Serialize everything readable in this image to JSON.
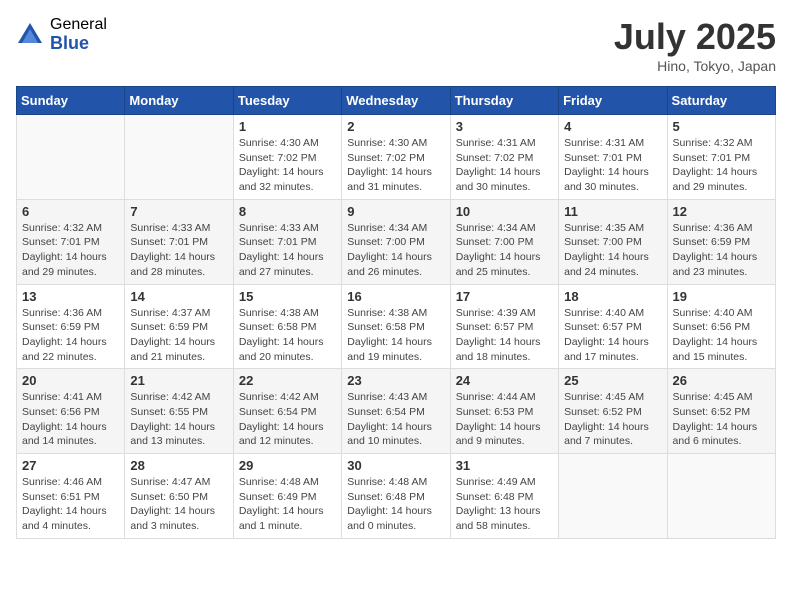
{
  "header": {
    "logo_general": "General",
    "logo_blue": "Blue",
    "month_year": "July 2025",
    "location": "Hino, Tokyo, Japan"
  },
  "weekdays": [
    "Sunday",
    "Monday",
    "Tuesday",
    "Wednesday",
    "Thursday",
    "Friday",
    "Saturday"
  ],
  "weeks": [
    [
      {
        "day": "",
        "sunrise": "",
        "sunset": "",
        "daylight": ""
      },
      {
        "day": "",
        "sunrise": "",
        "sunset": "",
        "daylight": ""
      },
      {
        "day": "1",
        "sunrise": "Sunrise: 4:30 AM",
        "sunset": "Sunset: 7:02 PM",
        "daylight": "Daylight: 14 hours and 32 minutes."
      },
      {
        "day": "2",
        "sunrise": "Sunrise: 4:30 AM",
        "sunset": "Sunset: 7:02 PM",
        "daylight": "Daylight: 14 hours and 31 minutes."
      },
      {
        "day": "3",
        "sunrise": "Sunrise: 4:31 AM",
        "sunset": "Sunset: 7:02 PM",
        "daylight": "Daylight: 14 hours and 30 minutes."
      },
      {
        "day": "4",
        "sunrise": "Sunrise: 4:31 AM",
        "sunset": "Sunset: 7:01 PM",
        "daylight": "Daylight: 14 hours and 30 minutes."
      },
      {
        "day": "5",
        "sunrise": "Sunrise: 4:32 AM",
        "sunset": "Sunset: 7:01 PM",
        "daylight": "Daylight: 14 hours and 29 minutes."
      }
    ],
    [
      {
        "day": "6",
        "sunrise": "Sunrise: 4:32 AM",
        "sunset": "Sunset: 7:01 PM",
        "daylight": "Daylight: 14 hours and 29 minutes."
      },
      {
        "day": "7",
        "sunrise": "Sunrise: 4:33 AM",
        "sunset": "Sunset: 7:01 PM",
        "daylight": "Daylight: 14 hours and 28 minutes."
      },
      {
        "day": "8",
        "sunrise": "Sunrise: 4:33 AM",
        "sunset": "Sunset: 7:01 PM",
        "daylight": "Daylight: 14 hours and 27 minutes."
      },
      {
        "day": "9",
        "sunrise": "Sunrise: 4:34 AM",
        "sunset": "Sunset: 7:00 PM",
        "daylight": "Daylight: 14 hours and 26 minutes."
      },
      {
        "day": "10",
        "sunrise": "Sunrise: 4:34 AM",
        "sunset": "Sunset: 7:00 PM",
        "daylight": "Daylight: 14 hours and 25 minutes."
      },
      {
        "day": "11",
        "sunrise": "Sunrise: 4:35 AM",
        "sunset": "Sunset: 7:00 PM",
        "daylight": "Daylight: 14 hours and 24 minutes."
      },
      {
        "day": "12",
        "sunrise": "Sunrise: 4:36 AM",
        "sunset": "Sunset: 6:59 PM",
        "daylight": "Daylight: 14 hours and 23 minutes."
      }
    ],
    [
      {
        "day": "13",
        "sunrise": "Sunrise: 4:36 AM",
        "sunset": "Sunset: 6:59 PM",
        "daylight": "Daylight: 14 hours and 22 minutes."
      },
      {
        "day": "14",
        "sunrise": "Sunrise: 4:37 AM",
        "sunset": "Sunset: 6:59 PM",
        "daylight": "Daylight: 14 hours and 21 minutes."
      },
      {
        "day": "15",
        "sunrise": "Sunrise: 4:38 AM",
        "sunset": "Sunset: 6:58 PM",
        "daylight": "Daylight: 14 hours and 20 minutes."
      },
      {
        "day": "16",
        "sunrise": "Sunrise: 4:38 AM",
        "sunset": "Sunset: 6:58 PM",
        "daylight": "Daylight: 14 hours and 19 minutes."
      },
      {
        "day": "17",
        "sunrise": "Sunrise: 4:39 AM",
        "sunset": "Sunset: 6:57 PM",
        "daylight": "Daylight: 14 hours and 18 minutes."
      },
      {
        "day": "18",
        "sunrise": "Sunrise: 4:40 AM",
        "sunset": "Sunset: 6:57 PM",
        "daylight": "Daylight: 14 hours and 17 minutes."
      },
      {
        "day": "19",
        "sunrise": "Sunrise: 4:40 AM",
        "sunset": "Sunset: 6:56 PM",
        "daylight": "Daylight: 14 hours and 15 minutes."
      }
    ],
    [
      {
        "day": "20",
        "sunrise": "Sunrise: 4:41 AM",
        "sunset": "Sunset: 6:56 PM",
        "daylight": "Daylight: 14 hours and 14 minutes."
      },
      {
        "day": "21",
        "sunrise": "Sunrise: 4:42 AM",
        "sunset": "Sunset: 6:55 PM",
        "daylight": "Daylight: 14 hours and 13 minutes."
      },
      {
        "day": "22",
        "sunrise": "Sunrise: 4:42 AM",
        "sunset": "Sunset: 6:54 PM",
        "daylight": "Daylight: 14 hours and 12 minutes."
      },
      {
        "day": "23",
        "sunrise": "Sunrise: 4:43 AM",
        "sunset": "Sunset: 6:54 PM",
        "daylight": "Daylight: 14 hours and 10 minutes."
      },
      {
        "day": "24",
        "sunrise": "Sunrise: 4:44 AM",
        "sunset": "Sunset: 6:53 PM",
        "daylight": "Daylight: 14 hours and 9 minutes."
      },
      {
        "day": "25",
        "sunrise": "Sunrise: 4:45 AM",
        "sunset": "Sunset: 6:52 PM",
        "daylight": "Daylight: 14 hours and 7 minutes."
      },
      {
        "day": "26",
        "sunrise": "Sunrise: 4:45 AM",
        "sunset": "Sunset: 6:52 PM",
        "daylight": "Daylight: 14 hours and 6 minutes."
      }
    ],
    [
      {
        "day": "27",
        "sunrise": "Sunrise: 4:46 AM",
        "sunset": "Sunset: 6:51 PM",
        "daylight": "Daylight: 14 hours and 4 minutes."
      },
      {
        "day": "28",
        "sunrise": "Sunrise: 4:47 AM",
        "sunset": "Sunset: 6:50 PM",
        "daylight": "Daylight: 14 hours and 3 minutes."
      },
      {
        "day": "29",
        "sunrise": "Sunrise: 4:48 AM",
        "sunset": "Sunset: 6:49 PM",
        "daylight": "Daylight: 14 hours and 1 minute."
      },
      {
        "day": "30",
        "sunrise": "Sunrise: 4:48 AM",
        "sunset": "Sunset: 6:48 PM",
        "daylight": "Daylight: 14 hours and 0 minutes."
      },
      {
        "day": "31",
        "sunrise": "Sunrise: 4:49 AM",
        "sunset": "Sunset: 6:48 PM",
        "daylight": "Daylight: 13 hours and 58 minutes."
      },
      {
        "day": "",
        "sunrise": "",
        "sunset": "",
        "daylight": ""
      },
      {
        "day": "",
        "sunrise": "",
        "sunset": "",
        "daylight": ""
      }
    ]
  ]
}
